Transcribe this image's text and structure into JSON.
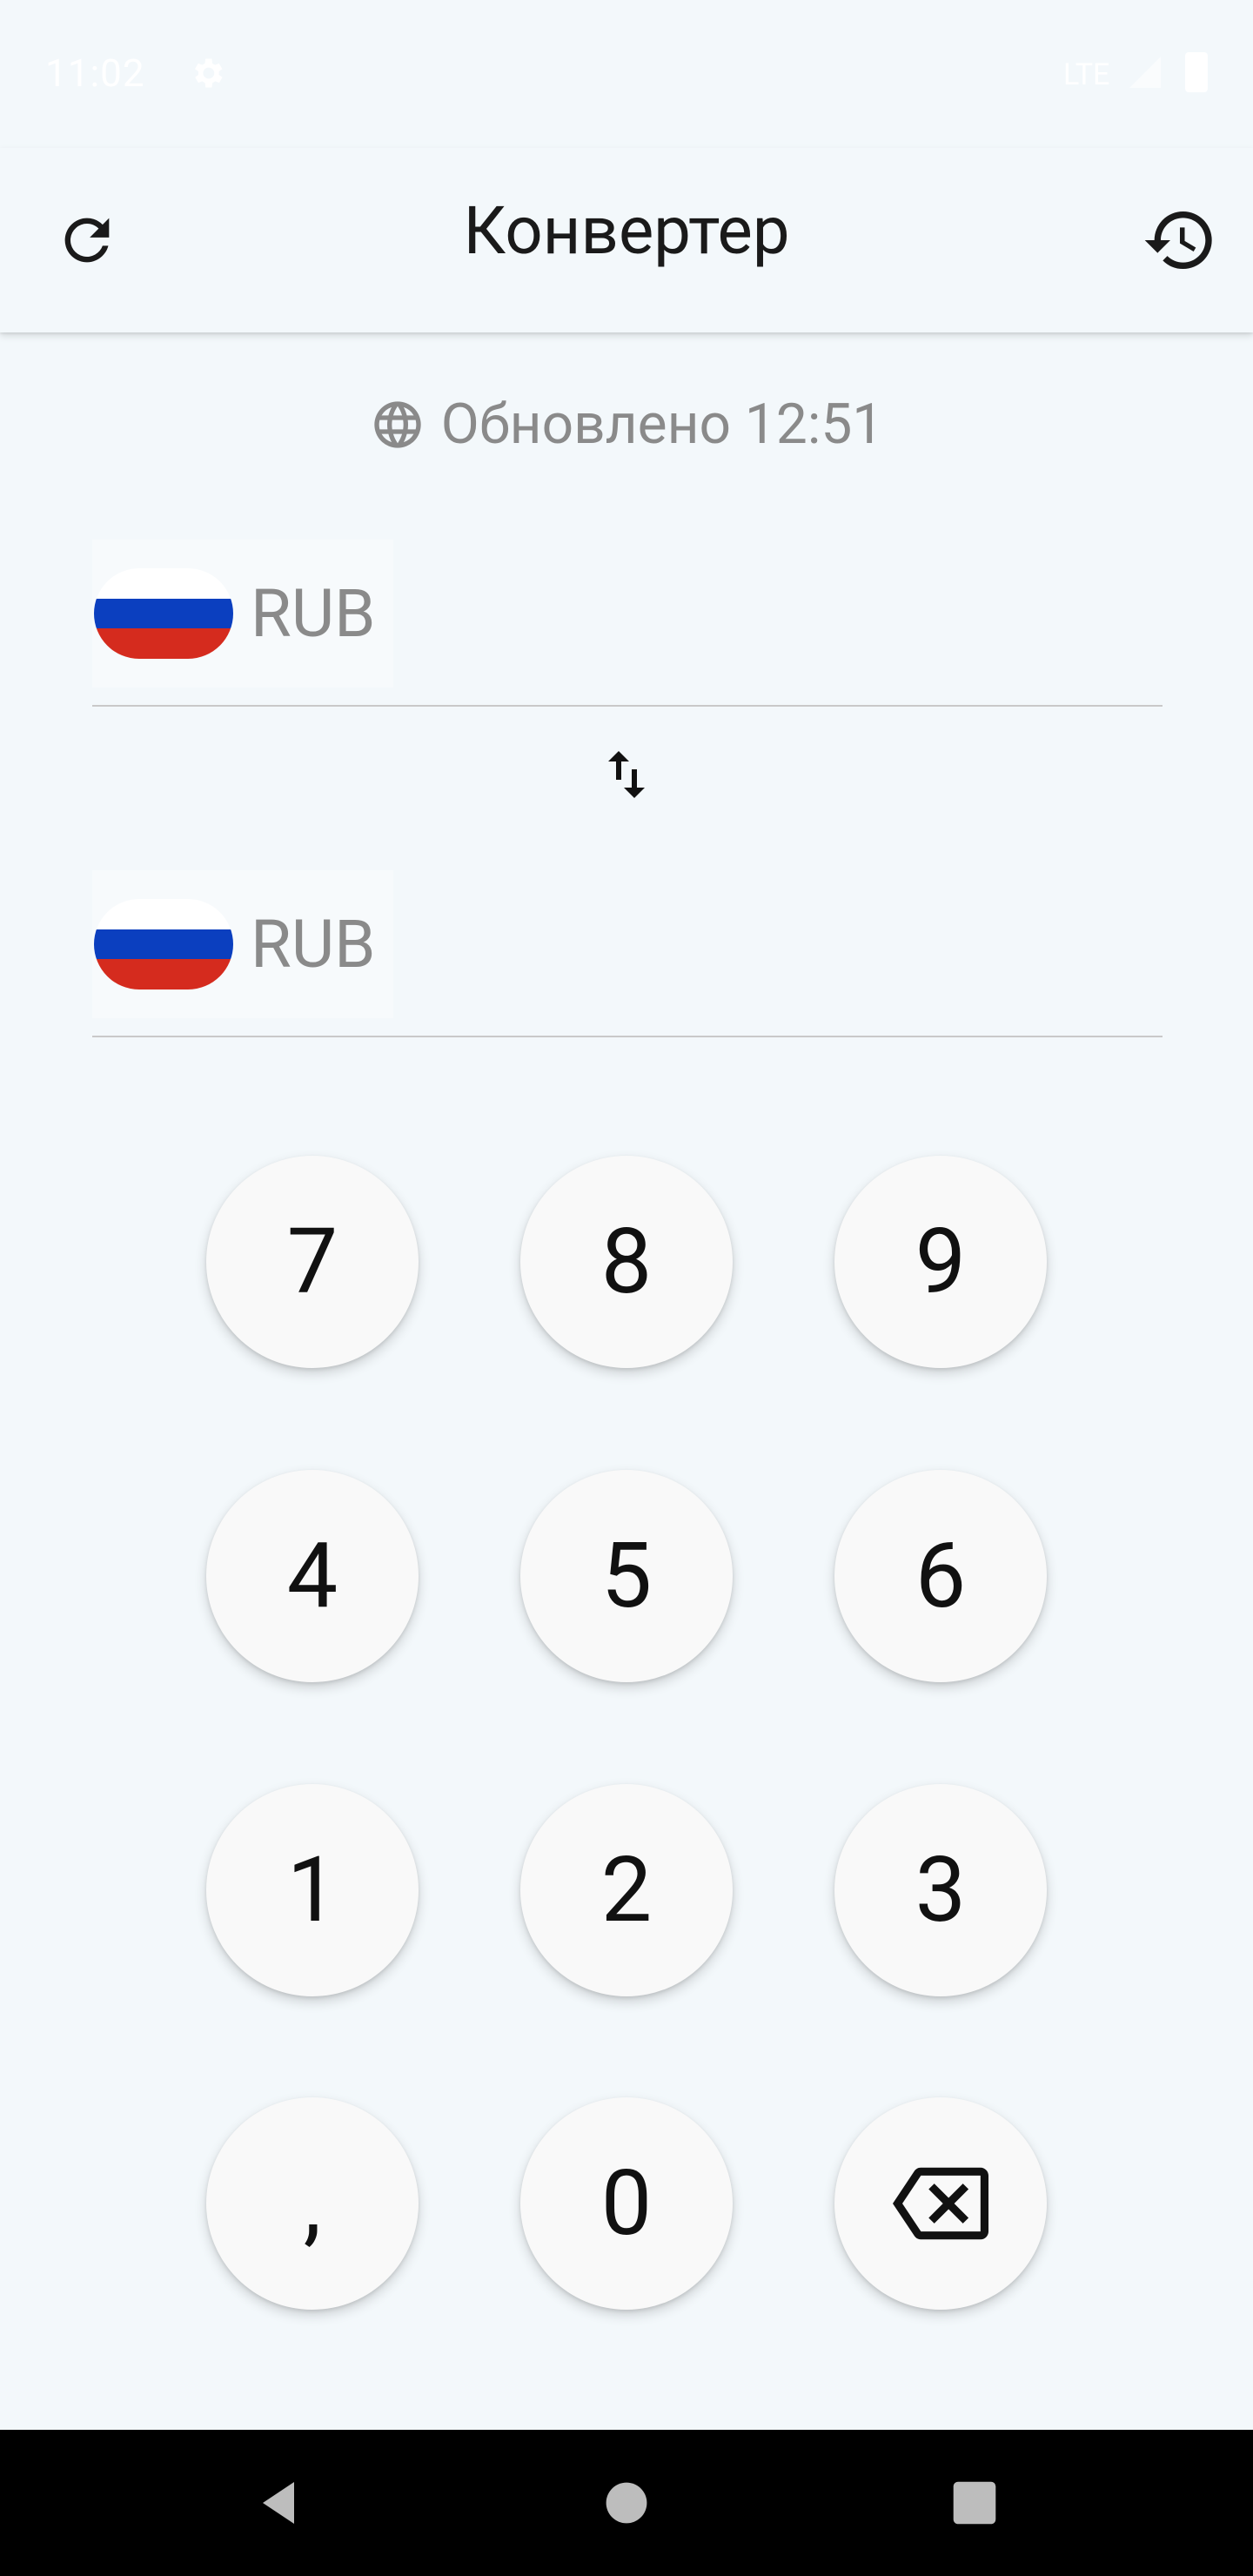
{
  "status_bar": {
    "time": "11:02",
    "network": "LTE",
    "icons": [
      "gear-icon",
      "signal-icon",
      "battery-icon"
    ]
  },
  "app_bar": {
    "title": "Конвертер",
    "left_icon": "refresh-icon",
    "right_icon": "history-icon"
  },
  "updated": {
    "icon": "globe-icon",
    "text": "Обновлено 12:51"
  },
  "converter": {
    "from": {
      "code": "RUB",
      "flag": "russia-flag"
    },
    "to": {
      "code": "RUB",
      "flag": "russia-flag"
    },
    "swap_icon": "swap-vertical-icon"
  },
  "keypad": {
    "keys": [
      "7",
      "8",
      "9",
      "4",
      "5",
      "6",
      "1",
      "2",
      "3",
      ",",
      "0"
    ],
    "backspace_icon": "backspace-icon"
  },
  "nav_bar": {
    "icons": [
      "back-icon",
      "home-icon",
      "recents-icon"
    ]
  },
  "colors": {
    "background": "#f3f8fb",
    "text_primary": "#1a1a1a",
    "text_secondary": "#8a8a8a",
    "key_background": "#f9f9f9",
    "flag_white": "#ffffff",
    "flag_blue": "#0b3fbf",
    "flag_red": "#d52b1e"
  }
}
